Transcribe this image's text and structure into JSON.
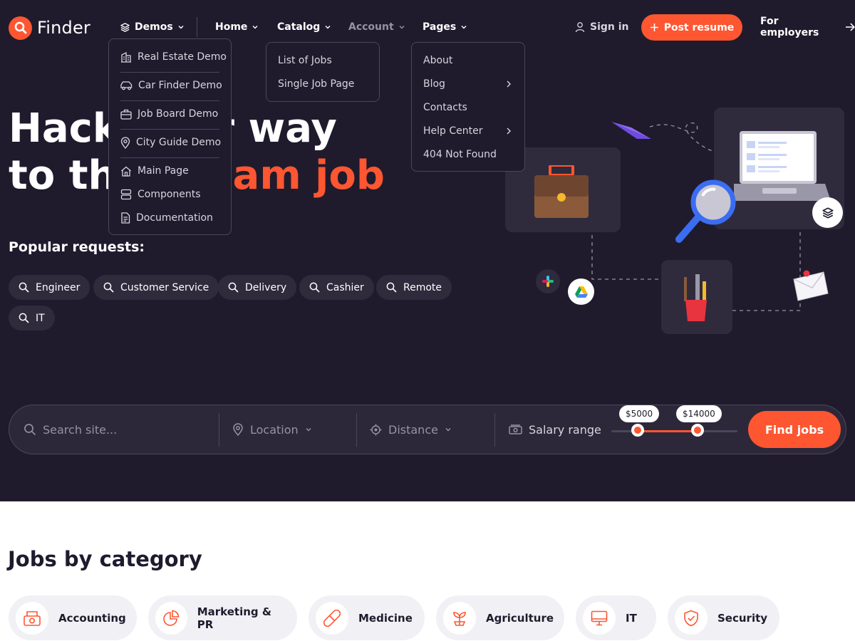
{
  "brand": {
    "name": "Finder",
    "accent": "#fd5631",
    "dark": "#1f1b2d"
  },
  "nav": {
    "demos": "Demos",
    "home": "Home",
    "catalog": "Catalog",
    "account": "Account",
    "pages": "Pages",
    "signin": "Sign in",
    "post_resume": "Post resume",
    "employers": "For employers"
  },
  "demos_menu": [
    {
      "label": "Real Estate Demo",
      "icon": "building-icon"
    },
    {
      "label": "Car Finder Demo",
      "icon": "car-icon"
    },
    {
      "label": "Job Board Demo",
      "icon": "briefcase-icon"
    },
    {
      "label": "City Guide Demo",
      "icon": "map-pin-icon"
    },
    {
      "label": "Main Page",
      "icon": "home-icon"
    },
    {
      "label": "Components",
      "icon": "components-icon"
    },
    {
      "label": "Documentation",
      "icon": "document-icon"
    }
  ],
  "catalog_menu": [
    "List of Jobs",
    "Single Job Page"
  ],
  "pages_menu": [
    {
      "label": "About",
      "submenu": false
    },
    {
      "label": "Blog",
      "submenu": true
    },
    {
      "label": "Contacts",
      "submenu": false
    },
    {
      "label": "Help Center",
      "submenu": true
    },
    {
      "label": "404 Not Found",
      "submenu": false
    }
  ],
  "hero": {
    "line1": "Hack your way",
    "line2_start": "to the ",
    "line2_accent": "dream job"
  },
  "popular": {
    "title": "Popular requests:",
    "chips": [
      "Engineer",
      "Customer Service",
      "Delivery",
      "Cashier",
      "Remote",
      "IT"
    ]
  },
  "search": {
    "placeholder": "Search site...",
    "location": "Location",
    "distance": "Distance",
    "salary": "Salary range",
    "salary_min": "$5000",
    "salary_max": "$14000",
    "find": "Find jobs"
  },
  "categories": {
    "title": "Jobs by category",
    "items": [
      {
        "label": "Accounting",
        "icon": "cash-register-icon"
      },
      {
        "label": "Marketing & PR",
        "icon": "pie-chart-icon"
      },
      {
        "label": "Medicine",
        "icon": "pill-icon"
      },
      {
        "label": "Agriculture",
        "icon": "plant-icon"
      },
      {
        "label": "IT",
        "icon": "monitor-icon"
      },
      {
        "label": "Security",
        "icon": "shield-icon"
      }
    ]
  }
}
